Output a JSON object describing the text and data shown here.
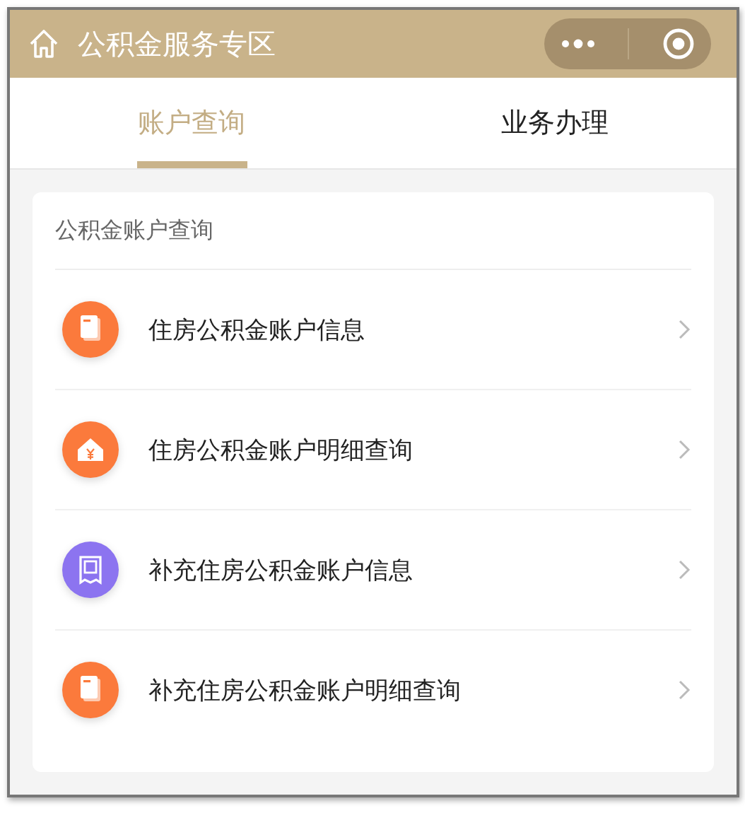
{
  "header": {
    "title": "公积金服务专区"
  },
  "tabs": [
    {
      "label": "账户查询",
      "selected": true
    },
    {
      "label": "业务办理",
      "selected": false
    }
  ],
  "section": {
    "title": "公积金账户查询",
    "items": [
      {
        "label": "住房公积金账户信息",
        "kind": "document",
        "color": "#fb7a3c"
      },
      {
        "label": "住房公积金账户明细查询",
        "kind": "house",
        "color": "#fb7a3c"
      },
      {
        "label": "补充住房公积金账户信息",
        "kind": "receipt",
        "color": "#8c74f0"
      },
      {
        "label": "补充住房公积金账户明细查询",
        "kind": "document",
        "color": "#fb7a3c"
      }
    ]
  }
}
